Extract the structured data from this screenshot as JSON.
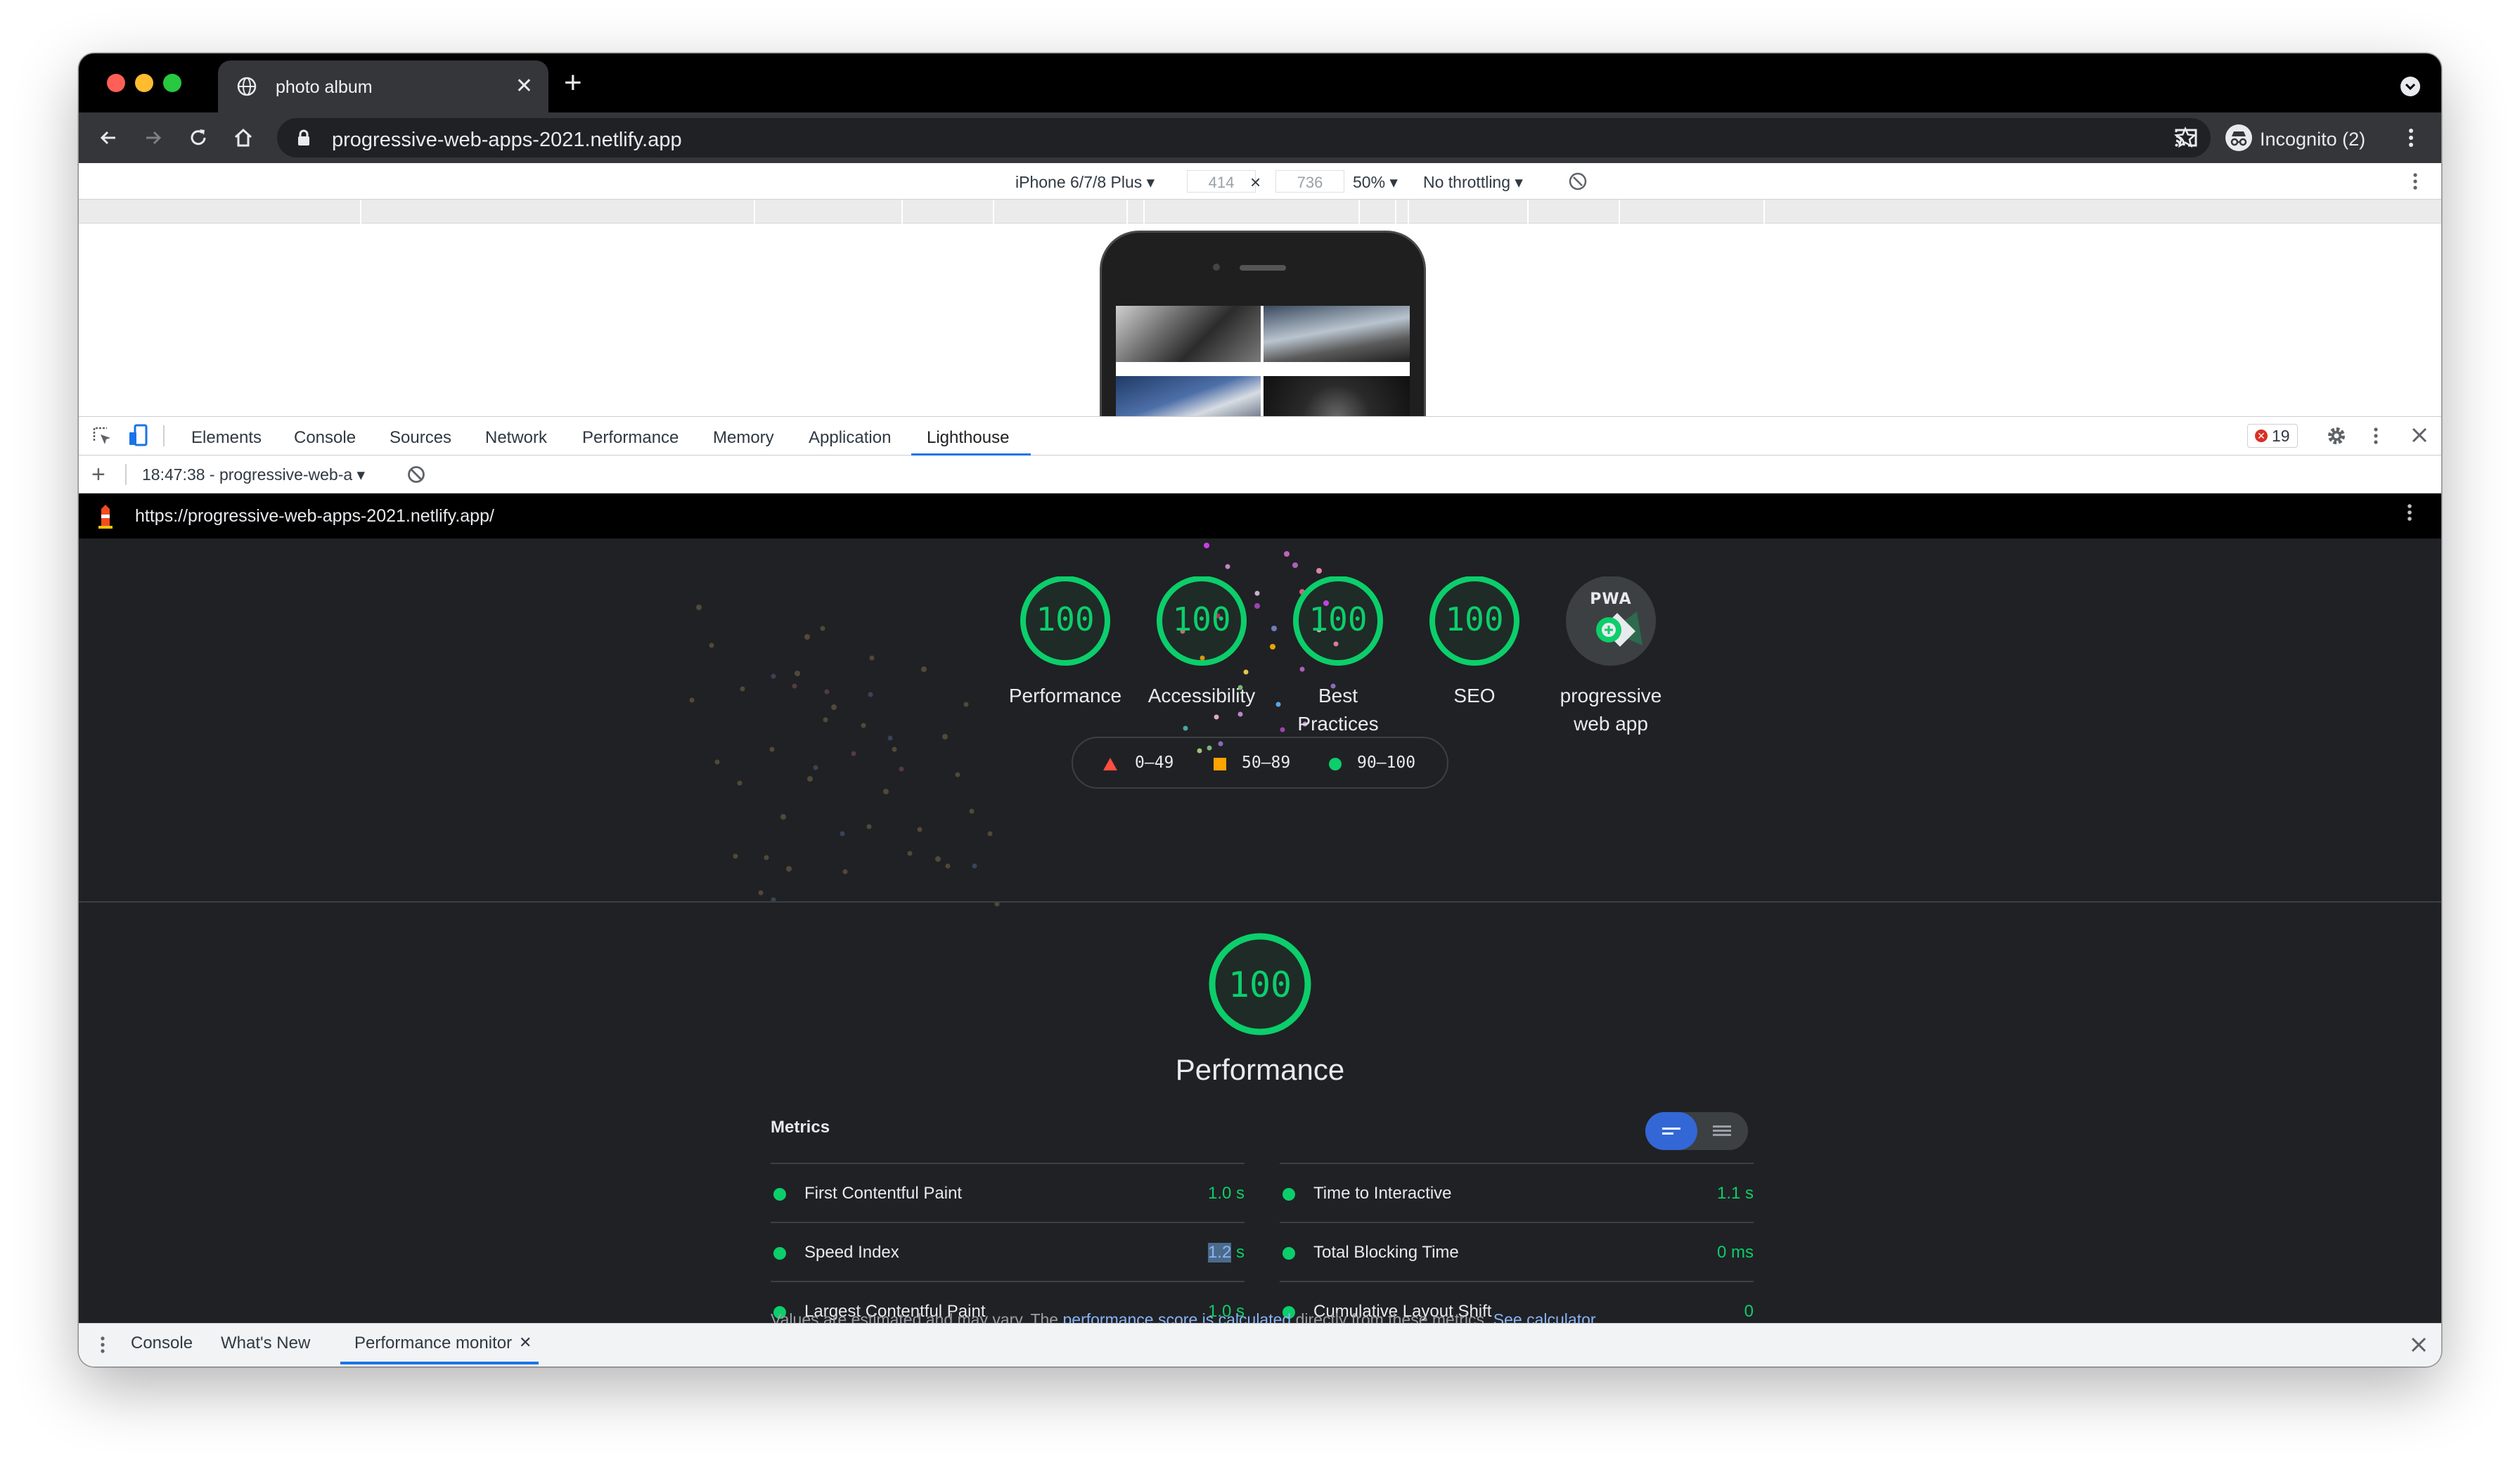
{
  "browser": {
    "tab_title": "photo album",
    "url": "progressive-web-apps-2021.netlify.app",
    "profile_label": "Incognito (2)"
  },
  "device_toolbar": {
    "device": "iPhone 6/7/8 Plus",
    "width": "414",
    "height": "736",
    "zoom": "50%",
    "throttling": "No throttling"
  },
  "devtools": {
    "tabs": [
      "Elements",
      "Console",
      "Sources",
      "Network",
      "Performance",
      "Memory",
      "Application",
      "Lighthouse"
    ],
    "active_tab": "Lighthouse",
    "error_count": "19",
    "report_selector": "18:47:38 - progressive-web-a"
  },
  "report": {
    "url": "https://progressive-web-apps-2021.netlify.app/",
    "categories": [
      {
        "score": "100",
        "label": "Performance"
      },
      {
        "score": "100",
        "label": "Accessibility"
      },
      {
        "score": "100",
        "label": "Best Practices"
      },
      {
        "score": "100",
        "label": "SEO"
      },
      {
        "score": "",
        "label": "progressive web app",
        "badge": "PWA"
      }
    ],
    "legend": [
      "0–49",
      "50–89",
      "90–100"
    ],
    "section": {
      "score": "100",
      "title": "Performance",
      "metrics_heading": "Metrics",
      "metrics": [
        {
          "name": "First Contentful Paint",
          "value": "1.0 s"
        },
        {
          "name": "Time to Interactive",
          "value": "1.1 s"
        },
        {
          "name": "Speed Index",
          "value_selected": "1.2",
          "value_unit": " s"
        },
        {
          "name": "Total Blocking Time",
          "value": "0 ms"
        },
        {
          "name": "Largest Contentful Paint",
          "value": "1.0 s"
        },
        {
          "name": "Cumulative Layout Shift",
          "value": "0"
        }
      ],
      "footnote": {
        "pre": "Values are estimated and may vary. The ",
        "link1": "performance score is calculated",
        "mid": " directly from these metrics. ",
        "link2": "See calculator."
      }
    },
    "colors": {
      "pass": "#0cce6b",
      "average": "#ffa400",
      "fail": "#ff4e42"
    }
  },
  "drawer": {
    "tabs": [
      "Console",
      "What's New",
      "Performance monitor"
    ],
    "active_tab": "Performance monitor"
  }
}
